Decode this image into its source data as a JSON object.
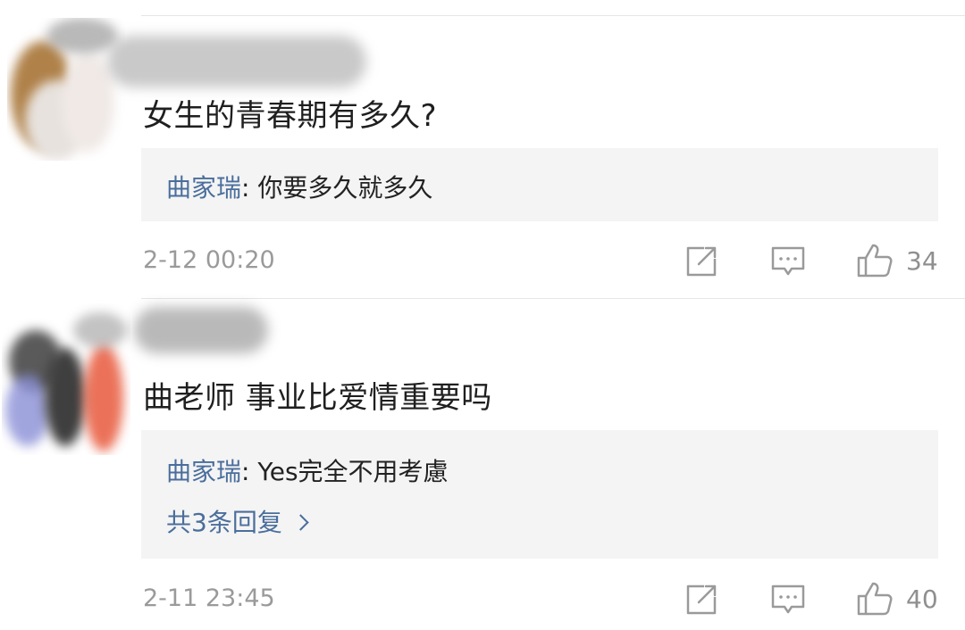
{
  "comments": [
    {
      "text": "女生的青春期有多久?",
      "reply": {
        "author": "曲家瑞",
        "separator": ": ",
        "text": "你要多久就多久"
      },
      "more_replies": "",
      "timestamp": "2-12 00:20",
      "likes": "34"
    },
    {
      "text": "曲老师 事业比爱情重要吗",
      "reply": {
        "author": "曲家瑞",
        "separator": ": ",
        "text": "Yes完全不用考慮"
      },
      "more_replies": "共3条回复",
      "timestamp": "2-11 23:45",
      "likes": "40"
    }
  ],
  "icons": {
    "share": "share-icon",
    "reply": "comment-icon",
    "like": "thumbs-up-icon"
  },
  "colors": {
    "link": "#4a6e9c",
    "reply_bg": "#f4f4f4",
    "icon": "#9a9a9a"
  }
}
